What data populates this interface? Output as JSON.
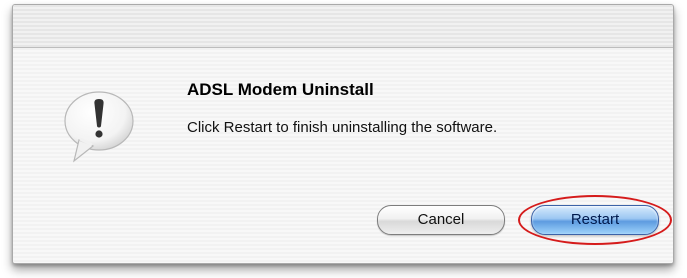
{
  "dialog": {
    "title": "ADSL Modem Uninstall",
    "message": "Click Restart to finish uninstalling the software.",
    "icon": "alert-speech-bubble-icon"
  },
  "buttons": {
    "cancel_label": "Cancel",
    "restart_label": "Restart"
  },
  "annotation": {
    "highlight_color": "#d51b1b",
    "highlight_target": "restart-button"
  },
  "colors": {
    "default_button": "#5d9be0",
    "dialog_background": "#f6f6f6"
  }
}
